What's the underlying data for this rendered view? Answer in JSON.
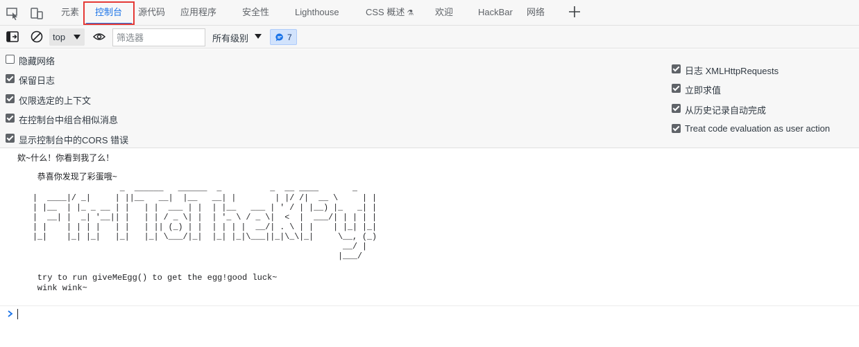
{
  "tabs": [
    {
      "label": "元素"
    },
    {
      "label": "控制台",
      "active": true
    },
    {
      "label": "源代码"
    },
    {
      "label": "应用程序"
    },
    {
      "label": "安全性"
    },
    {
      "label": "Lighthouse"
    },
    {
      "label": "CSS 概述"
    },
    {
      "label": "欢迎"
    },
    {
      "label": "HackBar"
    },
    {
      "label": "网络"
    }
  ],
  "toolbar": {
    "context": "top",
    "filter_placeholder": "筛选器",
    "levels": "所有级别",
    "issues_count": "7"
  },
  "settings_left": [
    {
      "label": "隐藏网络",
      "checked": false
    },
    {
      "label": "保留日志",
      "checked": true
    },
    {
      "label": "仅限选定的上下文",
      "checked": true
    },
    {
      "label": "在控制台中组合相似消息",
      "checked": true
    },
    {
      "label": "显示控制台中的CORS 错误",
      "checked": true
    }
  ],
  "settings_right": [
    {
      "label": "日志 XMLHttpRequests",
      "checked": true
    },
    {
      "label": "立即求值",
      "checked": true
    },
    {
      "label": "从历史记录自动完成",
      "checked": true
    },
    {
      "label": "Treat code evaluation as user action",
      "checked": true
    }
  ],
  "console": {
    "line1": "欸~什么！你看到我了么！",
    "line2": "    恭喜你发现了彩蛋哦~",
    "ascii_art": "                  _  ______   ______  _          _  __ ____       _\n|  ____|/ _|     | ||__   __|  |__   __| |        | |/ /|  __ \\     | |\n| |__  | |_ _ __ | |   | |  ___ | |  | |__   ___ | ' / | |__) |_   _| |\n|  __| |  _| '__|| |   | | / _ \\| |  | '_ \\ / _ \\|  <  |  ___/| | | | |\n| |    | | | |   | |   | || (_) | |  | | | |  __/| . \\ | |    | |_| |_|\n|_|    |_| |_|   |_|   |_| \\___/|_|  |_| |_|\\___||_|\\_\\|_|     \\__, (_)\n                                                                __/ |\n                                                               |___/",
    "line3": "    try to run giveMeEgg() to get the egg!good luck~",
    "line4": "    wink wink~"
  }
}
